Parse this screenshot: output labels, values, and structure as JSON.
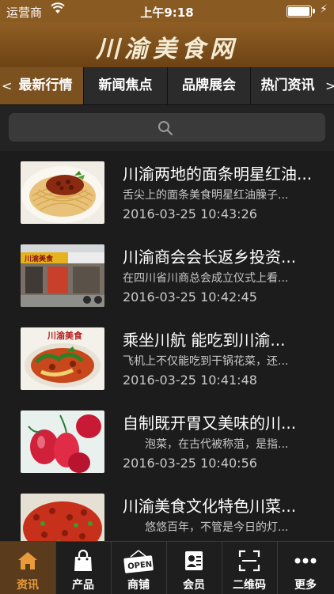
{
  "status": {
    "carrier": "运营商",
    "time": "上午9:18"
  },
  "header": {
    "title": "川渝美食网"
  },
  "tabs": {
    "left_arrow": "<",
    "right_arrow": ">",
    "items": [
      {
        "label": "最新行情"
      },
      {
        "label": "新闻焦点"
      },
      {
        "label": "品牌展会"
      },
      {
        "label": "热门资讯"
      }
    ]
  },
  "list": [
    {
      "title": "川渝两地的面条明星红油...",
      "summary": "舌尖上的面条美食明星红油臊子...",
      "date": "2016-03-25 10:43:26"
    },
    {
      "title": "川渝商会会长返乡投资...",
      "summary": "在四川省川商总会成立仪式上看...",
      "date": "2016-03-25 10:42:45"
    },
    {
      "title": "乘坐川航 能吃到川渝...",
      "summary": "飞机上不仅能吃到干锅花菜，还...",
      "date": "2016-03-25 10:41:48"
    },
    {
      "title": "自制既开胃又美味的川...",
      "summary": "　　泡菜，在古代被称菹，是指...",
      "date": "2016-03-25 10:40:56"
    },
    {
      "title": "川渝美食文化特色川菜...",
      "summary": "　　悠悠百年，不管是今日的灯...",
      "date": ""
    }
  ],
  "thumb_text": {
    "shop_sign": "川渝美食",
    "dish_sign": "川渝美食"
  },
  "nav": [
    {
      "label": "资讯",
      "icon": "home-icon"
    },
    {
      "label": "产品",
      "icon": "bag-icon"
    },
    {
      "label": "商铺",
      "icon": "open-sign-icon"
    },
    {
      "label": "会员",
      "icon": "member-card-icon"
    },
    {
      "label": "二维码",
      "icon": "qr-scan-icon"
    },
    {
      "label": "更多",
      "icon": "more-icon"
    }
  ],
  "colors": {
    "accent": "#7c5120",
    "header": "#8a5a23",
    "nav_active_text": "#e99a3a",
    "background": "#1c1c1c"
  }
}
